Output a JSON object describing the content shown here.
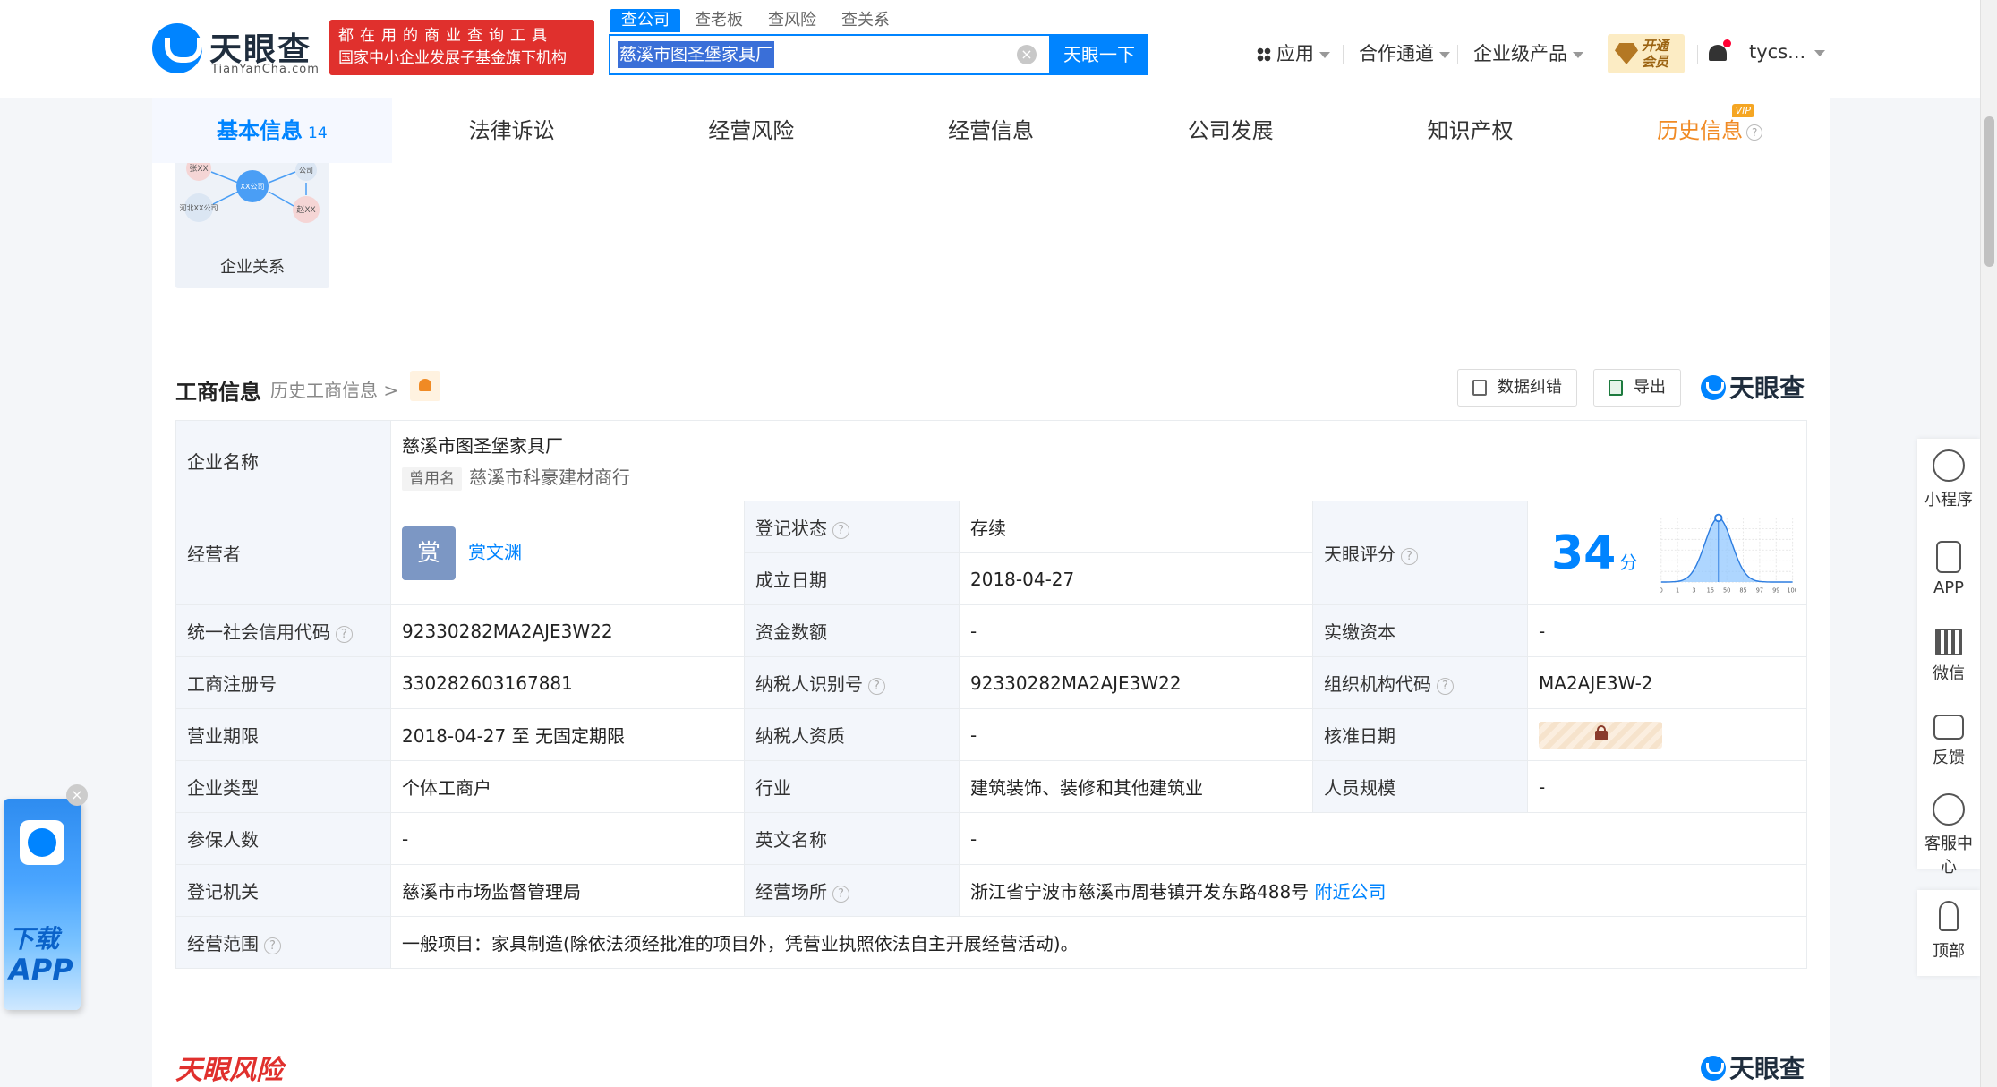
{
  "header": {
    "logo_name": "天眼查",
    "logo_sub": "TianYanCha.com",
    "slogan_line1": "都在用的商业查询工具",
    "slogan_line2": "国家中小企业发展子基金旗下机构",
    "search_tabs": [
      "查公司",
      "查老板",
      "查风险",
      "查关系"
    ],
    "search_value": "慈溪市图圣堡家具厂",
    "search_clear": "×",
    "search_button": "天眼一下",
    "nav": {
      "apps": "应用",
      "partner": "合作通道",
      "enterprise": "企业级产品"
    },
    "vip_line1": "开通",
    "vip_line2": "会员",
    "user": "tycs..."
  },
  "tabs": [
    {
      "label": "基本信息",
      "count": "14"
    },
    {
      "label": "法律诉讼"
    },
    {
      "label": "经营风险"
    },
    {
      "label": "经营信息"
    },
    {
      "label": "公司发展"
    },
    {
      "label": "知识产权"
    },
    {
      "label": "历史信息",
      "tag": "VIP"
    }
  ],
  "relation": {
    "label": "企业关系",
    "nodes": [
      "张XX",
      "XX公司",
      "公司",
      "河北XX公司",
      "赵XX"
    ]
  },
  "section": {
    "title": "工商信息",
    "history_link": "历史工商信息 >",
    "correct_btn": "数据纠错",
    "export_btn": "导出",
    "brand": "天眼查"
  },
  "table": {
    "company_name_label": "企业名称",
    "company_name": "慈溪市图圣堡家具厂",
    "alias_tag": "曾用名",
    "alias": "慈溪市科豪建材商行",
    "operator_label": "经营者",
    "operator_avatar": "赏",
    "operator": "赏文渊",
    "reg_status_label": "登记状态",
    "reg_status": "存续",
    "found_date_label": "成立日期",
    "found_date": "2018-04-27",
    "score_label": "天眼评分",
    "score": "34",
    "score_unit": "分",
    "credit_code_label": "统一社会信用代码",
    "credit_code": "92330282MA2AJE3W22",
    "capital_label": "资金数额",
    "capital": "-",
    "paid_capital_label": "实缴资本",
    "paid_capital": "-",
    "reg_no_label": "工商注册号",
    "reg_no": "330282603167881",
    "taxpayer_id_label": "纳税人识别号",
    "taxpayer_id": "92330282MA2AJE3W22",
    "org_code_label": "组织机构代码",
    "org_code": "MA2AJE3W-2",
    "term_label": "营业期限",
    "term": "2018-04-27 至 无固定期限",
    "tax_qual_label": "纳税人资质",
    "tax_qual": "-",
    "approve_label": "核准日期",
    "type_label": "企业类型",
    "type": "个体工商户",
    "industry_label": "行业",
    "industry": "建筑装饰、装修和其他建筑业",
    "staff_label": "人员规模",
    "staff": "-",
    "insured_label": "参保人数",
    "insured": "-",
    "english_label": "英文名称",
    "english": "-",
    "authority_label": "登记机关",
    "authority": "慈溪市市场监督管理局",
    "address_label": "经营场所",
    "address": "浙江省宁波市慈溪市周巷镇开发东路488号",
    "nearby": "附近公司",
    "scope_label": "经营范围",
    "scope": "一般项目：家具制造(除依法须经批准的项目外，凭营业执照依法自主开展经营活动)。"
  },
  "score_chart": {
    "x_ticks": [
      "0",
      "1",
      "3",
      "15",
      "50",
      "85",
      "97",
      "99",
      "100"
    ]
  },
  "risk_title": "天眼风险",
  "side": {
    "mini": "小程序",
    "app": "APP",
    "wechat": "微信",
    "feedback": "反馈",
    "service": "客服中心",
    "top": "顶部"
  },
  "download": {
    "line1": "下载",
    "line2": "APP",
    "close": "×"
  },
  "colors": {
    "brand": "#0084ff",
    "slogan_red": "#e0302d",
    "history_orange": "#f08a24",
    "status_green": "#13a35b"
  }
}
